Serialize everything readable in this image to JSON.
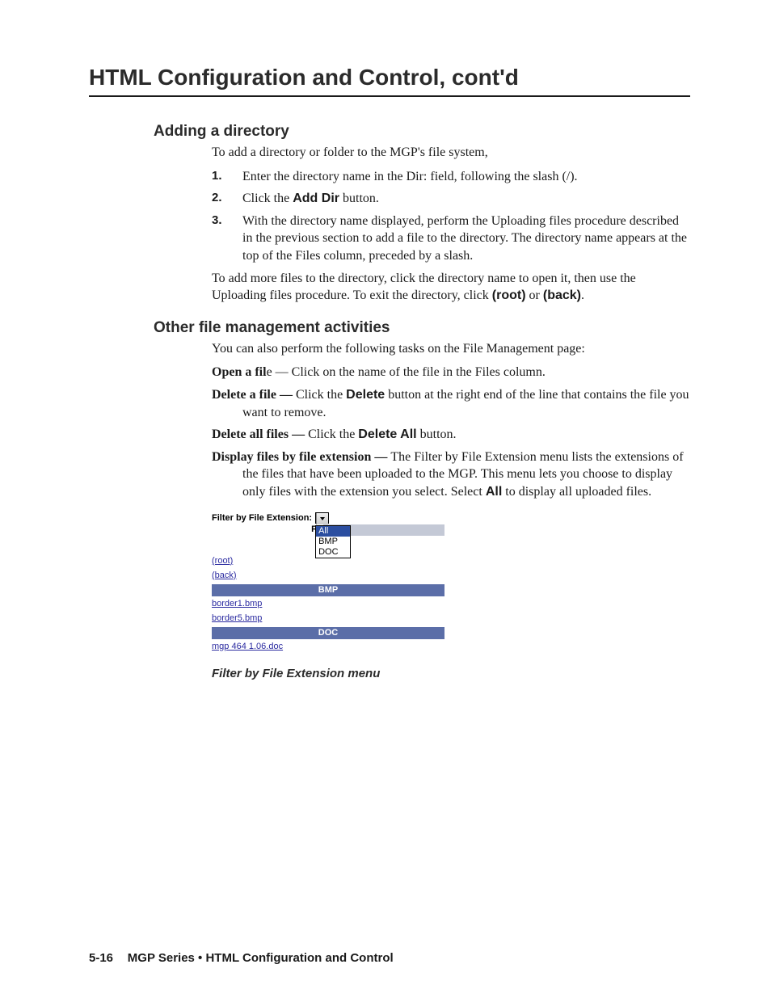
{
  "title": "HTML Configuration and Control, cont'd",
  "sections": {
    "addDir": {
      "heading": "Adding a directory",
      "intro": "To add a directory or folder to the MGP's file system,",
      "steps": {
        "n1": "1",
        "t1": "Enter the directory name in the Dir: field, following the slash (/).",
        "n2": "2",
        "t2a": "Click the ",
        "t2b": "Add Dir",
        "t2c": " button.",
        "n3": "3",
        "t3": "With the directory name displayed, perform the Uploading files procedure described in the previous section to add a file to the directory.  The directory name appears at the top of the Files column, preceded by a slash."
      },
      "note_a": "To add more files to the directory, click the directory name to open it, then use the Uploading files procedure.  To exit the directory, click ",
      "note_b": "(root)",
      "note_c": " or ",
      "note_d": "(back)",
      "note_e": "."
    },
    "other": {
      "heading": "Other file management activities",
      "intro": "You can also perform the following tasks on the File Management page:",
      "open_a": "Open a fil",
      "open_b": "e — ",
      "open_c": "Click on the name of the file in the Files column.",
      "del_a": "Delete a file — ",
      "del_b": "Click the ",
      "del_c": "Delete",
      "del_d": " button at the right end of the line that contains the file you want to remove.",
      "da_a": "Delete all files — ",
      "da_b": "Click the ",
      "da_c": "Delete All",
      "da_d": " button.",
      "df_a": "Display files by file extension — ",
      "df_b": "The Filter by File Extension menu lists the extensions of the files that have been uploaded to the MGP.  This menu lets you choose to display only files with the extension you select.  Select ",
      "df_c": "All",
      "df_d": " to display all uploaded files."
    }
  },
  "shot": {
    "filterLabel": "Filter by File Extension:",
    "ddValue": "All",
    "ddOpts": {
      "o1": "All",
      "o2": "BMP",
      "o3": "DOC"
    },
    "fileHdrPrefix": "Fil",
    "root": "(root)",
    "back": "(back)",
    "ext1": "BMP",
    "f1": "border1.bmp",
    "f2": "border5.bmp",
    "ext2": "DOC",
    "f3": "mgp 464 1.06.doc"
  },
  "caption": "Filter by File Extension menu",
  "footer": {
    "page": "5-16",
    "text": "MGP Series • HTML Configuration and Control"
  }
}
